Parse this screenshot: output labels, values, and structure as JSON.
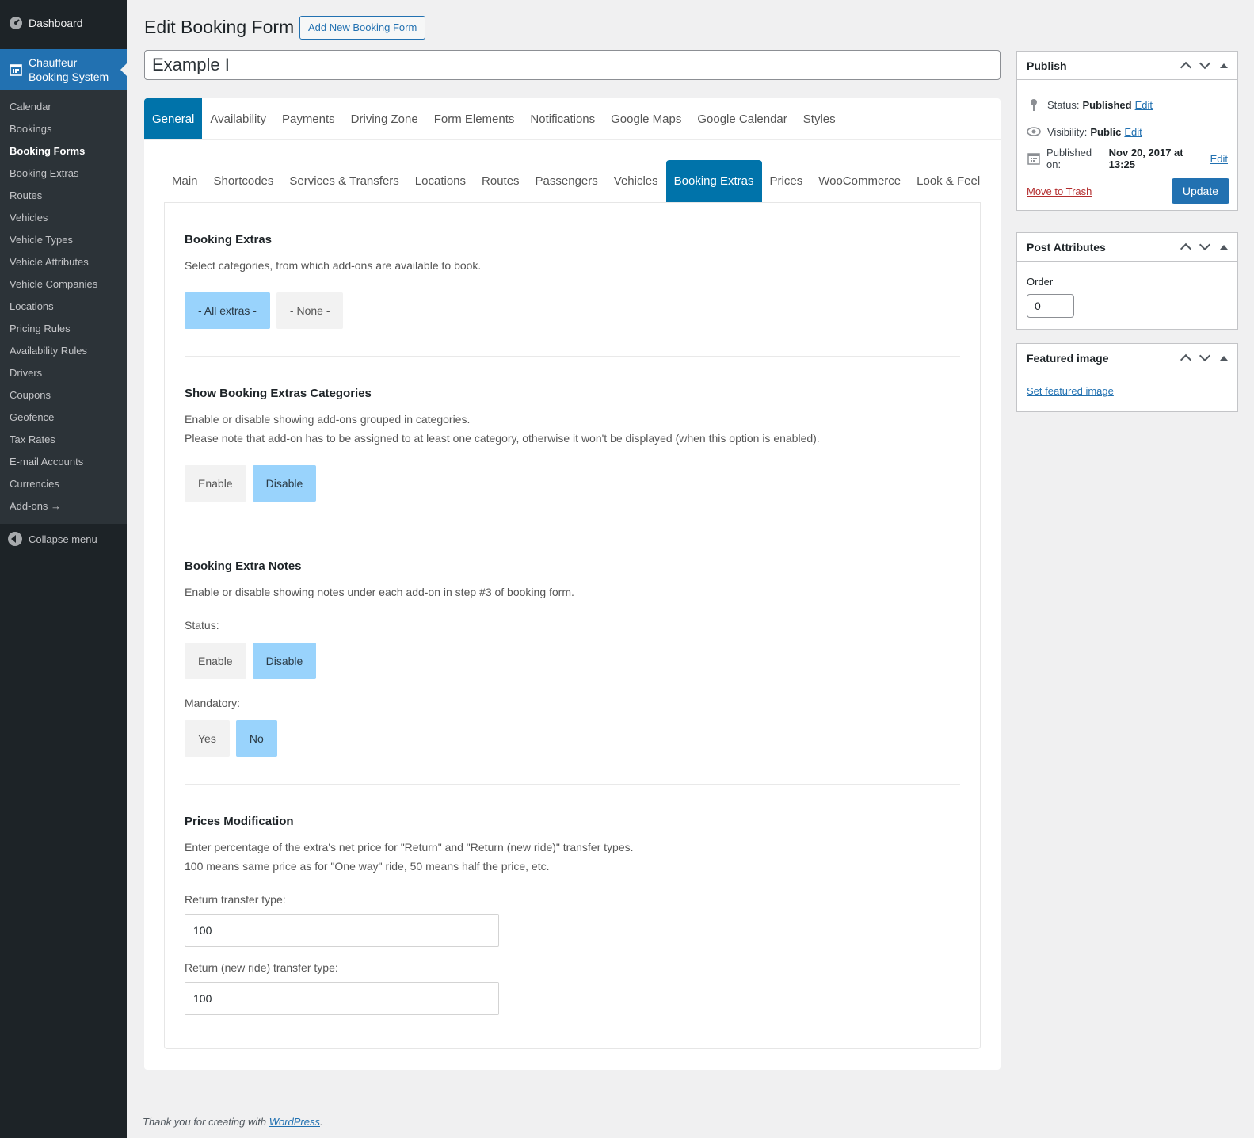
{
  "sidebar": {
    "dashboard": "Dashboard",
    "plugin": [
      "Chauffeur",
      "Booking System"
    ],
    "items": [
      "Calendar",
      "Bookings",
      "Booking Forms",
      "Booking Extras",
      "Routes",
      "Vehicles",
      "Vehicle Types",
      "Vehicle Attributes",
      "Vehicle Companies",
      "Locations",
      "Pricing Rules",
      "Availability Rules",
      "Drivers",
      "Coupons",
      "Geofence",
      "Tax Rates",
      "E-mail Accounts",
      "Currencies",
      "Add-ons →"
    ],
    "collapse": "Collapse menu"
  },
  "header": {
    "title": "Edit Booking Form",
    "add_new": "Add New Booking Form"
  },
  "post_title": "Example I",
  "tabs_main": [
    "General",
    "Availability",
    "Payments",
    "Driving Zone",
    "Form Elements",
    "Notifications",
    "Google Maps",
    "Google Calendar",
    "Styles"
  ],
  "tabs_sub": [
    "Main",
    "Shortcodes",
    "Services & Transfers",
    "Locations",
    "Routes",
    "Passengers",
    "Vehicles",
    "Booking Extras",
    "Prices",
    "WooCommerce",
    "Look & Feel"
  ],
  "sections": {
    "extras": {
      "title": "Booking Extras",
      "desc": "Select categories, from which add-ons are available to book.",
      "btn_all": "- All extras -",
      "btn_none": "- None -"
    },
    "categories": {
      "title": "Show Booking Extras Categories",
      "desc1": "Enable or disable showing add-ons grouped in categories.",
      "desc2": "Please note that add-on has to be assigned to at least one category, otherwise it won't be displayed (when this option is enabled).",
      "enable": "Enable",
      "disable": "Disable"
    },
    "notes": {
      "title": "Booking Extra Notes",
      "desc": "Enable or disable showing notes under each add-on in step #3 of booking form.",
      "status_label": "Status:",
      "enable": "Enable",
      "disable": "Disable",
      "mandatory_label": "Mandatory:",
      "yes": "Yes",
      "no": "No"
    },
    "prices": {
      "title": "Prices Modification",
      "desc1": "Enter percentage of the extra's net price for \"Return\" and \"Return (new ride)\" transfer types.",
      "desc2": "100 means same price as for \"One way\" ride, 50 means half the price, etc.",
      "return_label": "Return transfer type:",
      "return_value": "100",
      "return_new_label": "Return (new ride) transfer type:",
      "return_new_value": "100"
    }
  },
  "publish": {
    "title": "Publish",
    "status_label": "Status:",
    "status_value": "Published",
    "visibility_label": "Visibility:",
    "visibility_value": "Public",
    "published_label": "Published on:",
    "published_value": "Nov 20, 2017 at 13:25",
    "edit": "Edit",
    "trash": "Move to Trash",
    "update": "Update"
  },
  "attributes": {
    "title": "Post Attributes",
    "order_label": "Order",
    "order_value": "0"
  },
  "featured": {
    "title": "Featured image",
    "link": "Set featured image"
  },
  "footer": {
    "text": "Thank you for creating with ",
    "link": "WordPress",
    "end": "."
  }
}
